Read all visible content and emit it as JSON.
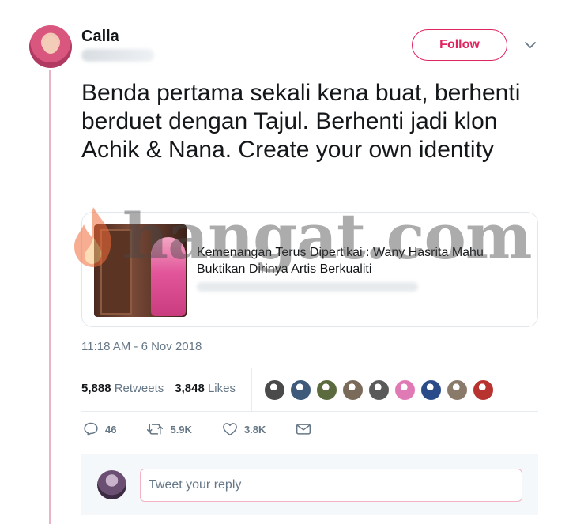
{
  "author": {
    "display_name": "Calla"
  },
  "follow_button": {
    "label": "Follow"
  },
  "tweet": {
    "text": "Benda pertama sekali kena buat, berhenti berduet dengan Tajul. Berhenti jadi klon Achik & Nana. Create your own identity",
    "timestamp": "11:18 AM - 6 Nov 2018"
  },
  "card": {
    "title": "Kemenangan Terus Dipertikai : Wany Hasrita Mahu Buktikan Dirinya Artis Berkualiti"
  },
  "watermark": {
    "text": "hangat.com"
  },
  "stats": {
    "retweets_count": "5,888",
    "retweets_label": "Retweets",
    "likes_count": "3,848",
    "likes_label": "Likes"
  },
  "likers": [
    {
      "color": "#4a4a4a"
    },
    {
      "color": "#3d5a7a"
    },
    {
      "color": "#5b6b3e"
    },
    {
      "color": "#7a6a5a"
    },
    {
      "color": "#5a5a5a"
    },
    {
      "color": "#e07ab4"
    },
    {
      "color": "#2a4a8a"
    },
    {
      "color": "#8a7a6a"
    },
    {
      "color": "#b8322f"
    }
  ],
  "actions": {
    "reply_count": "46",
    "retweet_count": "5.9K",
    "like_count": "3.8K"
  },
  "reply": {
    "placeholder": "Tweet your reply"
  },
  "colors": {
    "accent": "#e0245e",
    "thread_line": "#e8b4c8",
    "muted_text": "#657786"
  },
  "icons": [
    "chevron-down-icon",
    "reply-icon",
    "retweet-icon",
    "heart-icon",
    "direct-message-icon",
    "flame-icon"
  ]
}
